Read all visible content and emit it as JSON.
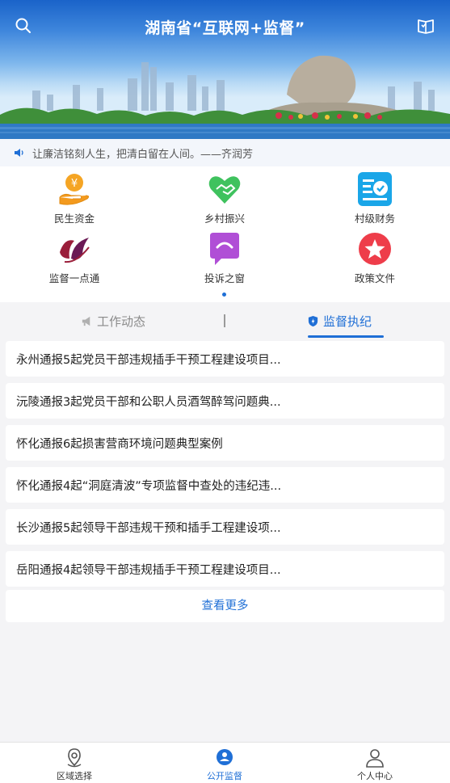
{
  "header": {
    "title": "湖南省“互联网+监督”"
  },
  "notice": {
    "text": "让廉洁铭刻人生，把清白留在人间。——齐润芳"
  },
  "grid": {
    "items": [
      {
        "label": "民生资金",
        "icon": "money-hand-icon"
      },
      {
        "label": "乡村振兴",
        "icon": "heart-handshake-icon"
      },
      {
        "label": "村级财务",
        "icon": "finance-check-icon"
      },
      {
        "label": "监督一点通",
        "icon": "supervision-logo-icon"
      },
      {
        "label": "投诉之窗",
        "icon": "complaint-chat-icon"
      },
      {
        "label": "政策文件",
        "icon": "star-badge-icon"
      }
    ]
  },
  "tabs": [
    {
      "label": "工作动态",
      "active": false,
      "icon": "megaphone-icon"
    },
    {
      "label": "监督执纪",
      "active": true,
      "icon": "shield-icon"
    }
  ],
  "news": [
    "永州通报5起党员干部违规插手干预工程建设项目...",
    "沅陵通报3起党员干部和公职人员酒驾醉驾问题典...",
    "怀化通报6起损害营商环境问题典型案例",
    "怀化通报4起“洞庭清波”专项监督中查处的违纪违...",
    "长沙通报5起领导干部违规干预和插手工程建设项...",
    "岳阳通报4起领导干部违规插手干预工程建设项目..."
  ],
  "more_label": "查看更多",
  "bottom_nav": [
    {
      "label": "区域选择",
      "icon": "location-icon",
      "active": false
    },
    {
      "label": "公开监督",
      "icon": "supervision-badge-icon",
      "active": true
    },
    {
      "label": "个人中心",
      "icon": "user-icon",
      "active": false
    }
  ],
  "colors": {
    "accent": "#1f6fd6",
    "banner_top": "#1a63c9",
    "background": "#f4f4f6"
  }
}
